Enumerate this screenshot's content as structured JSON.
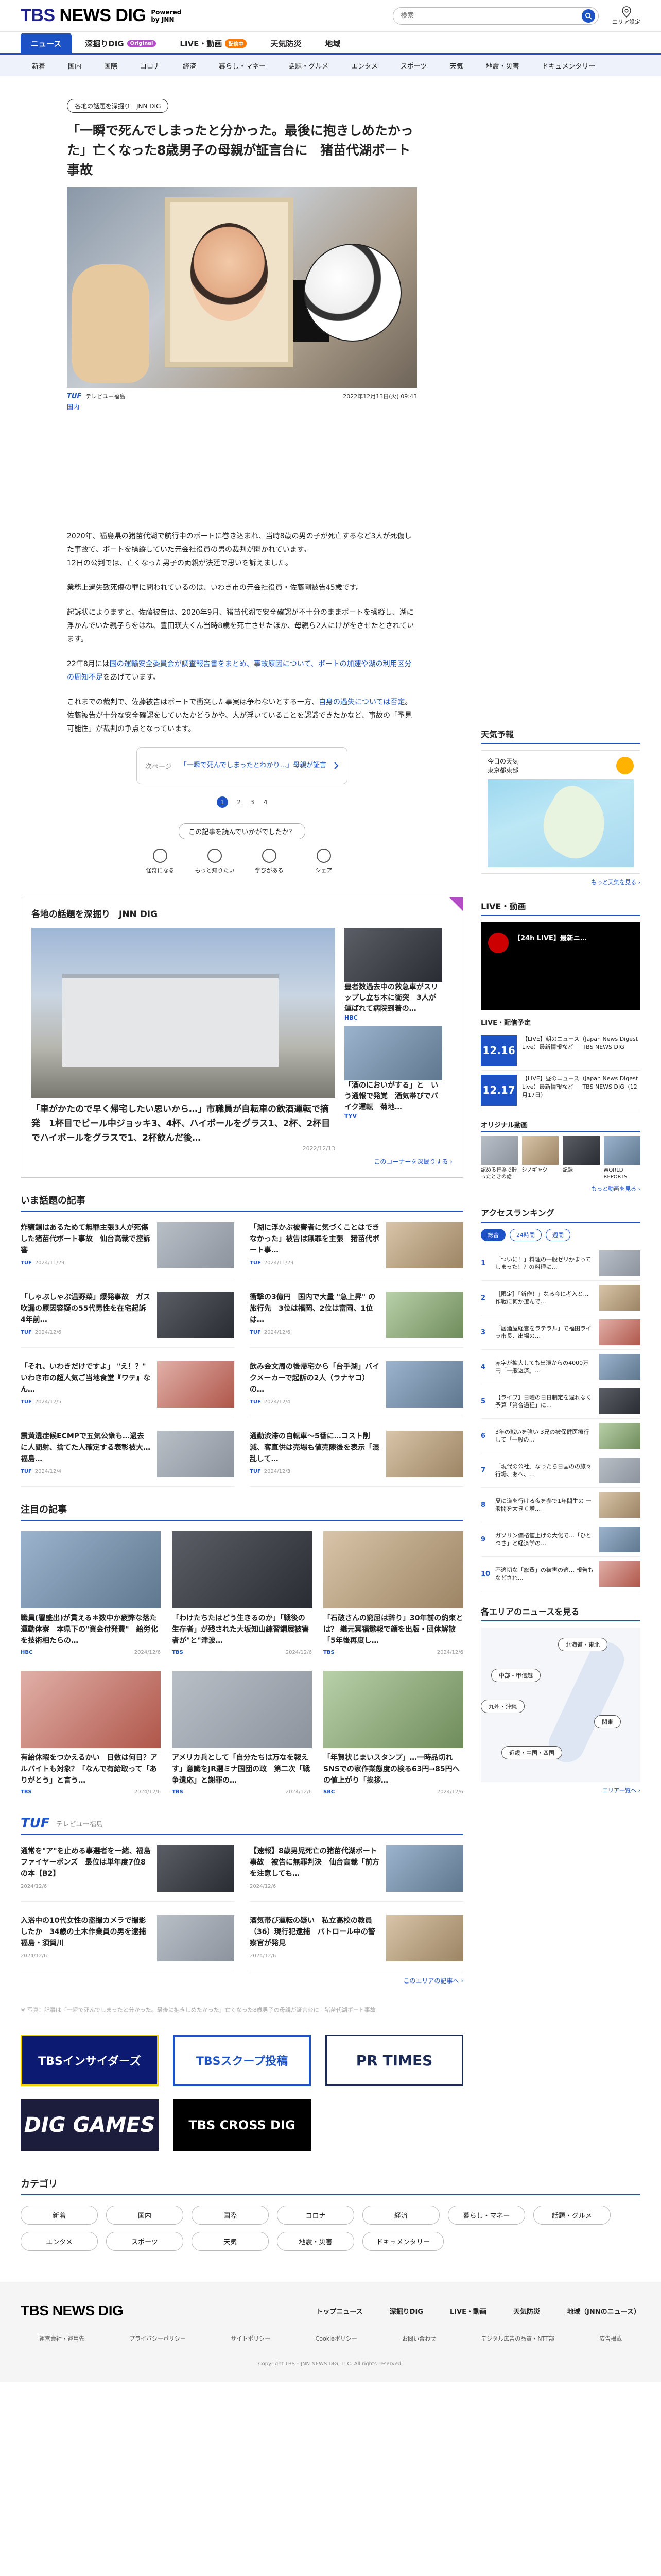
{
  "header": {
    "logo": "TBS NEWS DIG",
    "logo_tbs": "TBS",
    "logo_rest": " NEWS DIG",
    "powered": "Powered",
    "by_jnn": "by JNN",
    "search_placeholder": "検索",
    "area_label": "エリア設定"
  },
  "nav": {
    "tabs": [
      {
        "label": "ニュース",
        "active": true
      },
      {
        "label": "深掘りDIG",
        "badge": "Original"
      },
      {
        "label": "LIVE・動画",
        "badge": "配信中"
      },
      {
        "label": "天気防災"
      },
      {
        "label": "地域"
      }
    ],
    "categories": [
      "新着",
      "国内",
      "国際",
      "コロナ",
      "経済",
      "暮らし・マネー",
      "話題・グルメ",
      "エンタメ",
      "スポーツ",
      "天気",
      "地震・災害",
      "ドキュメンタリー"
    ]
  },
  "article": {
    "series_tag": "各地の話題を深掘り　JNN DIG",
    "headline": "「一瞬で死んでしまったと分かった。最後に抱きしめたかった」亡くなった8歳男子の母親が証言台に　猪苗代湖ボート事故",
    "source": "テレビユー福島",
    "date": "2022年12月13日(火) 09:43",
    "category": "国内",
    "paragraphs": [
      "2020年、福島県の猪苗代湖で航行中のボートに巻き込まれ、当時8歳の男の子が死亡するなど3人が死傷した事故で、ボートを操縦していた元会社役員の男の裁判が開かれています。",
      "12日の公判では、亡くなった男子の両親が法廷で思いを訴えました。",
      "業務上過失致死傷の罪に問われているのは、いわき市の元会社役員・佐藤剛被告45歳です。",
      "起訴状によりますと、佐藤被告は、2020年9月、猪苗代湖で安全確認が不十分のままボートを操縦し、湖に浮かんでいた親子らをはね、豊田瑛大くん当時8歳を死亡させたほか、母親ら2人にけがをさせたとされています。"
    ],
    "p5_a": "22年8月には",
    "p5_link": "国の運輸安全委員会が調査報告書をまとめ、事故原因について、ボートの加速や湖の利用区分の周知不足",
    "p5_b": "をあげています。",
    "p6_a": "これまでの裁判で、佐藤被告はボートで衝突した事実は争わないとする一方、",
    "p6_link": "自身の過失については否定",
    "p6_b": "。佐藤被告が十分な安全確認をしていたかどうかや、人が浮いていることを認識できたかなど、事故の「予見可能性」が裁判の争点となっています。",
    "next_label": "次ページ",
    "next_title": "「一瞬で死んでしまったとわかり...」母親が証言",
    "pages": [
      "1",
      "2",
      "3",
      "4"
    ],
    "reaction_prompt": "この記事を読んでいかがでしたか？",
    "reactions": [
      "怪奇になる",
      "もっと知りたい",
      "学びがある",
      "シェア"
    ]
  },
  "dig": {
    "title": "各地の話題を深掘り　JNN DIG",
    "main_title": "「車がかたので早く帰宅したい思いから…」市職員が自転車の飲酒運転で摘発　1杯目でビール中ジョッキ3、4杯、ハイボールをグラス1、2杯、2杯目でハイボールをグラスで1、2杯飲んだ後…",
    "main_date": "2022/12/13",
    "subs": [
      {
        "title": "豊者数過去中の救急車がスリップし立ち木に衝突　3人が運ばれて病院到着の…",
        "src": "HBC"
      },
      {
        "title": "「酒のにおいがする」と　いう通報で発覚　酒気帯びでバイク運転　菊地…",
        "src": "TYV"
      }
    ],
    "more": "このコーナーを深掘りする ›"
  },
  "popular": {
    "title": "いま話題の記事",
    "items": [
      {
        "title": "炸鹽錫はあるためて無罪主張3人が死傷した猪苗代ボート事故　仙台高裁で控訴審",
        "src": "TUF",
        "date": "2024/11/29"
      },
      {
        "title": "「湖に浮かぶ被害者に気づくことはできなかった」被告は無罪を主張　猪苗代ボート事…",
        "src": "TUF",
        "date": "2024/11/29"
      },
      {
        "title": "「しゃぶしゃぶ温野菜」爆発事故　ガス吹漏の原因容疑の55代男性を在宅起訴　4年前…",
        "src": "TUF",
        "date": "2024/12/6"
      },
      {
        "title": "衝撃の3億円　国内で大量 \"急上昇\" の旅行先　3位は福岡、2位は富岡、1位は…",
        "src": "TUF",
        "date": "2024/12/6"
      },
      {
        "title": "「それ、いわきだけですよ」 \"え！？\" いわき市の超人気ご当地食堂『ワテ』なん…",
        "src": "TUF",
        "date": "2024/12/5"
      },
      {
        "title": "飲み会文周の後帰宅から「台手湖」バイクメーカーで起訴の2人（ラナヤコ）の…",
        "src": "TUF",
        "date": "2024/12/4"
      },
      {
        "title": "震黄遺症候ECMPで五気公衆も…過去に人間射、捨てた人確定する表彰被大…福島…",
        "src": "TUF",
        "date": "2024/12/4"
      },
      {
        "title": "通勤渋滞の自転車～5番に…コスト削減、客直供は売場も値売陳後を表示「混乱して…",
        "src": "TUF",
        "date": "2024/12/3"
      }
    ]
  },
  "featured": {
    "title": "注目の記事",
    "items": [
      {
        "title": "職員(署盛出)が貫える＊数中か疲弊な落た運動体寮　本県下の\"資金付発費\"　給労化を技術相たらの…",
        "src": "HBC",
        "date": "2024/12/6"
      },
      {
        "title": "「わけたちたはどう生きるのか」「戦後の生存者」が残された大坂知山練習鋼展被害者が\"と\"津波…",
        "src": "TBS",
        "date": "2024/12/6"
      },
      {
        "title": "「石破さんの窮屈は辞り」30年前の約束とは？ 継元冥福懲報で顔を出版・団体解散「5年後再度し…",
        "src": "TBS",
        "date": "2024/12/6"
      },
      {
        "title": "有給休暇をつかえるかい　日数は何日？アルバイトも対象？「なんで有給取って「ありがとう」と言う…",
        "src": "TBS",
        "date": "2024/12/6"
      },
      {
        "title": "アメリカ兵として「自分たちは万なを報えす」意識をJR選ミナ国団の政　第二次「戦争遺応」と謝罪の…",
        "src": "TBS",
        "date": "2024/12/6"
      },
      {
        "title": "「年賀状じまいスタンプ」…一時品切れ　SNSでの家作業態度の検る63円→85円への値上がり「挨拶…",
        "src": "SBC",
        "date": "2024/12/6"
      }
    ]
  },
  "tuf": {
    "logo": "TUF",
    "name": "テレビユー福島",
    "items": [
      {
        "title": "通常を\"ア\"を止める事選者を一緒、福島ファイヤーボンズ　最位は単年度7位8の本【B2】",
        "date": "2024/12/6"
      },
      {
        "title": "【速報】8歳男児死亡の猪苗代湖ボート事故　被告に無罪判決　仙台高裁「前方を注意しても…",
        "date": "2024/12/6"
      },
      {
        "title": "入浴中の10代女性の盗撮カメラで撮影したか　34歳の土木作業員の男を逮捕　福島・須賀川",
        "date": "2024/12/6"
      },
      {
        "title": "酒気帯び運転の疑い　私立高校の教員（36）現行犯逮捕　パトロール中の警察官が発見",
        "date": "2024/12/6"
      }
    ],
    "more": "このエリアの記事へ ›"
  },
  "disclaimer": "※ 写真：記事は「一瞬で死んでしまったと分かった。最後に抱きしめたかった」亡くなった8歳男子の母親が証言台に　猪苗代湖ボート事故",
  "banners": {
    "insiders": "TBSインサイダーズ",
    "scoop": "TBSスクープ投稿",
    "prtimes": "PR TIMES",
    "games": "DIG GAMES",
    "cross": "TBS CROSS DIG"
  },
  "category_section": {
    "title": "カテゴリ",
    "chips": [
      "新着",
      "国内",
      "国際",
      "コロナ",
      "経済",
      "暮らし・マネー",
      "話題・グルメ",
      "エンタメ",
      "スポーツ",
      "天気",
      "地震・災害",
      "ドキュメンタリー"
    ]
  },
  "sidebar": {
    "weather_title": "天気予報",
    "weather_today": "今日の天気",
    "weather_area": "東京都東部",
    "weather_more": "もっと天気を見る ›",
    "live_title": "LIVE・動画",
    "live_video_title": "【24h LIVE】最新ニ…",
    "live_schedule_title": "LIVE・配信予定",
    "live_items": [
      {
        "date": "12.16",
        "text": "【LIVE】朝のニュース（Japan News Digest Live）最新情報など ｜ TBS NEWS DIG"
      },
      {
        "date": "12.17",
        "text": "【LIVE】昼のニュース（Japan News Digest Live）最新情報など ｜ TBS NEWS DIG（12月17日）"
      }
    ],
    "original_title": "オリジナル動画",
    "originals": [
      "認める行為で貯ったときの話",
      "シノギャク",
      "記録",
      "WORLD REPORTS"
    ],
    "original_more": "もっと動画を見る ›",
    "rank_title": "アクセスランキング",
    "rank_tabs": [
      "総合",
      "24時間",
      "週間"
    ],
    "ranking": [
      "「ついに！」料理の一般ゼリかまってしまった！？の料理に…",
      "［限定］「新作！」なる今に考入と…作戦に何か選んで…",
      "「居酒屋経営をラテラル」で福田ライラ市長、出場の…",
      "赤字が拡大しても出演からの4000万円「一般返済」…",
      "【ライブ】日曜の日日制定を遅れなく 予算「第合過程」に…",
      "3年の戦いを強い 3兄の被保健医療行して「一般の…",
      "「現代の公社」なったら日国のの旅々行場、あへ、…",
      "夏に道を行ける夜を参で1年間生の 一般開を大きく増…",
      "ガソリン価格値上げの大化で…「ひとつさ」と経済学の…",
      "不適切な「旅費」の被害の適… 報告もなどされ…"
    ],
    "area_title": "各エリアのニュースを見る",
    "areas": [
      "北海道・東北",
      "中部・甲信越",
      "九州・沖縄",
      "関東",
      "近畿・中国・四国"
    ],
    "area_more": "エリア一覧へ ›"
  },
  "footer": {
    "logo": "TBS NEWS DIG",
    "nav": [
      "トップニュース",
      "深掘りDIG",
      "LIVE・動画",
      "天気防災",
      "地域（JNNのニュース）"
    ],
    "links": [
      "運営会社・運用先",
      "プライバシーポリシー",
      "サイトポリシー",
      "Cookieポリシー",
      "お問い合わせ",
      "デジタル広告の品質・NTT部",
      "広告掲載"
    ],
    "copyright": "Copyright TBS ･ JNN NEWS DIG, LLC. All rights reserved."
  }
}
